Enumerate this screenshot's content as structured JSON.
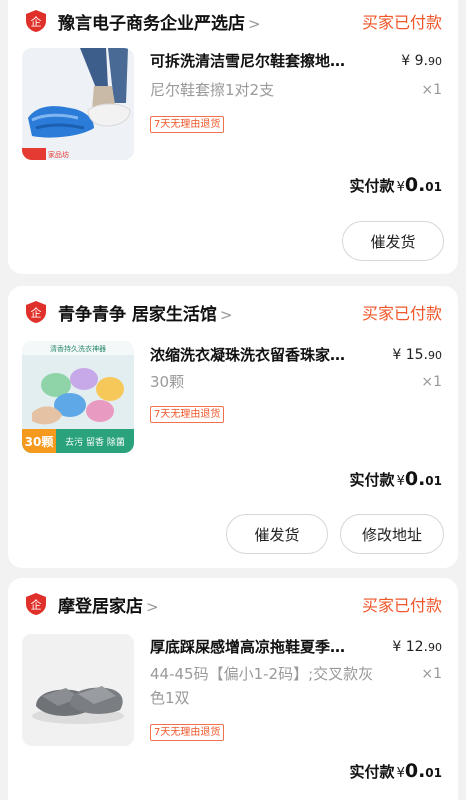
{
  "colors": {
    "accent": "#f0572a",
    "logo": "#e0302a"
  },
  "orders": [
    {
      "shop_name": "豫言电子商务企业严选店",
      "status": "买家已付款",
      "thumb_caption": "家品坊",
      "title": "可拆洗清洁雪尼尔鞋套擦地…",
      "spec": "尼尔鞋套擦1对2支",
      "price_symbol": "¥",
      "price_int": "9.",
      "price_dec": "90",
      "qty": "×1",
      "tag": "7天无理由退货",
      "paid_label": "实付款",
      "paid_cur": "¥",
      "paid_int": "0.",
      "paid_dec": "01",
      "buttons": [
        "催发货"
      ]
    },
    {
      "shop_name": "青争青争 居家生活馆",
      "status": "买家已付款",
      "thumb_caption": "清香持久洗衣神器",
      "thumb_badge": "30颗",
      "thumb_slogan": "去污 留香 除菌",
      "title": "浓缩洗衣凝珠洗衣留香珠家…",
      "spec": "30颗",
      "price_symbol": "¥",
      "price_int": "15.",
      "price_dec": "90",
      "qty": "×1",
      "tag": "7天无理由退货",
      "paid_label": "实付款",
      "paid_cur": "¥",
      "paid_int": "0.",
      "paid_dec": "01",
      "buttons": [
        "催发货",
        "修改地址"
      ]
    },
    {
      "shop_name": "摩登居家店",
      "status": "买家已付款",
      "title": "厚底踩屎感增高凉拖鞋夏季…",
      "spec": "44-45码【偏小1-2码】;交叉款灰色1双",
      "price_symbol": "¥",
      "price_int": "12.",
      "price_dec": "90",
      "qty": "×1",
      "tag": "7天无理由退货",
      "paid_label": "实付款",
      "paid_cur": "¥",
      "paid_int": "0.",
      "paid_dec": "01"
    }
  ]
}
